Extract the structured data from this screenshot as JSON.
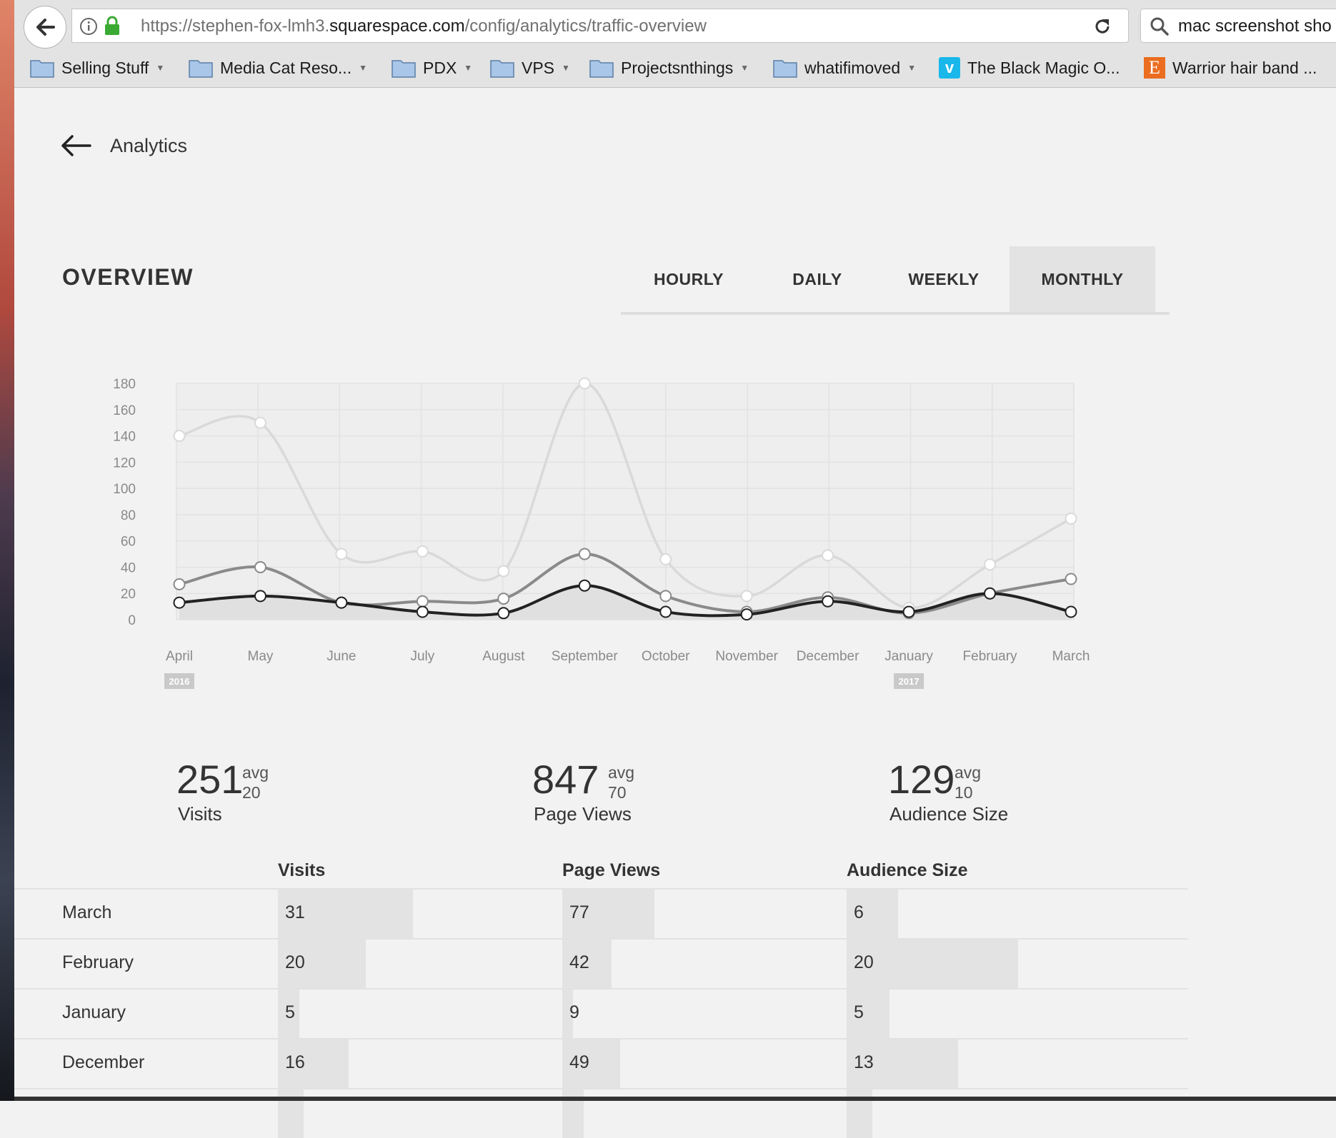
{
  "browser": {
    "url_prefix": "https://stephen-fox-lmh3.",
    "url_host": "squarespace.com",
    "url_path": "/config/analytics/traffic-overview",
    "search_value": "mac screenshot sho",
    "bookmarks": [
      {
        "label": "Selling Stuff",
        "icon": "folder-icon"
      },
      {
        "label": "Media Cat Reso...",
        "icon": "folder-icon"
      },
      {
        "label": "PDX",
        "icon": "folder-icon"
      },
      {
        "label": "VPS",
        "icon": "folder-icon"
      },
      {
        "label": "Projectsnthings",
        "icon": "folder-icon"
      },
      {
        "label": "whatifimoved",
        "icon": "folder-icon"
      },
      {
        "label": "The Black Magic O...",
        "icon": "vimeo-icon"
      },
      {
        "label": "Warrior hair band ...",
        "icon": "etsy-icon"
      }
    ]
  },
  "header": {
    "back_label": "Analytics"
  },
  "overview": {
    "title": "OVERVIEW",
    "tabs": [
      "HOURLY",
      "DAILY",
      "WEEKLY",
      "MONTHLY"
    ],
    "active_tab": "MONTHLY"
  },
  "chart_data": {
    "type": "line",
    "categories": [
      "April",
      "May",
      "June",
      "July",
      "August",
      "September",
      "October",
      "November",
      "December",
      "January",
      "February",
      "March"
    ],
    "year_markers": [
      {
        "category": "April",
        "label": "2016"
      },
      {
        "category": "January",
        "label": "2017"
      }
    ],
    "yticks": [
      0,
      20,
      40,
      60,
      80,
      100,
      120,
      140,
      160,
      180
    ],
    "ylim": [
      0,
      180
    ],
    "grid": true,
    "series": [
      {
        "values": [
          140,
          150,
          50,
          52,
          37,
          180,
          46,
          18,
          49,
          9,
          42,
          77
        ],
        "color": "#d9d9d9"
      },
      {
        "values": [
          27,
          40,
          13,
          14,
          16,
          50,
          18,
          6,
          17,
          5,
          20,
          31
        ],
        "color": "#8a8a8a"
      },
      {
        "values": [
          13,
          18,
          13,
          6,
          5,
          26,
          6,
          4,
          14,
          6,
          20,
          6
        ],
        "color": "#222222"
      }
    ]
  },
  "stats": [
    {
      "value": "251",
      "avg_label": "avg",
      "avg_value": "20",
      "label": "Visits"
    },
    {
      "value": "847",
      "avg_label": "avg",
      "avg_value": "70",
      "label": "Page Views"
    },
    {
      "value": "129",
      "avg_label": "avg",
      "avg_value": "10",
      "label": "Audience Size"
    }
  ],
  "table": {
    "columns": [
      "Visits",
      "Page Views",
      "Audience Size"
    ],
    "rows": [
      {
        "month": "March",
        "values": [
          "31",
          "77",
          "6"
        ],
        "fill": [
          0.63,
          0.43,
          0.24
        ]
      },
      {
        "month": "February",
        "values": [
          "20",
          "42",
          "20"
        ],
        "fill": [
          0.41,
          0.23,
          0.8
        ]
      },
      {
        "month": "January",
        "values": [
          "5",
          "9",
          "5"
        ],
        "fill": [
          0.1,
          0.05,
          0.2
        ]
      },
      {
        "month": "December",
        "values": [
          "16",
          "49",
          "13"
        ],
        "fill": [
          0.33,
          0.27,
          0.52
        ]
      },
      {
        "month": "",
        "values": [
          "",
          "",
          ""
        ],
        "fill": [
          0.12,
          0.1,
          0.12
        ]
      }
    ]
  }
}
